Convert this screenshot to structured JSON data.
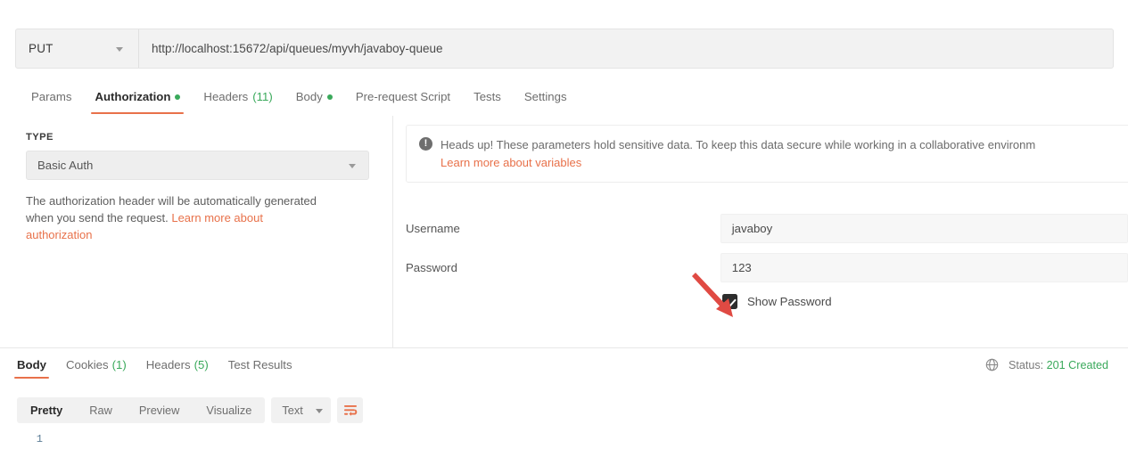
{
  "request": {
    "method": "PUT",
    "url": "http://localhost:15672/api/queues/myvh/javaboy-queue",
    "tabs": [
      {
        "label": "Params",
        "badge": "",
        "dot": false,
        "active": false
      },
      {
        "label": "Authorization",
        "badge": "",
        "dot": true,
        "active": true
      },
      {
        "label": "Headers",
        "badge": "(11)",
        "dot": false,
        "active": false
      },
      {
        "label": "Body",
        "badge": "",
        "dot": true,
        "active": false
      },
      {
        "label": "Pre-request Script",
        "badge": "",
        "dot": false,
        "active": false
      },
      {
        "label": "Tests",
        "badge": "",
        "dot": false,
        "active": false
      },
      {
        "label": "Settings",
        "badge": "",
        "dot": false,
        "active": false
      }
    ]
  },
  "auth": {
    "type_label": "TYPE",
    "type_value": "Basic Auth",
    "note_text": "The authorization header will be automatically generated when you send the request. ",
    "note_link": "Learn more about authorization",
    "notice_text": "Heads up! These parameters hold sensitive data. To keep this data secure while working in a collaborative environm",
    "notice_link": "Learn more about variables",
    "username_label": "Username",
    "username_value": "javaboy",
    "password_label": "Password",
    "password_value": "123",
    "show_password_label": "Show Password",
    "show_password_checked": true
  },
  "response": {
    "tabs": [
      {
        "label": "Body",
        "badge": "",
        "active": true
      },
      {
        "label": "Cookies",
        "badge": "(1)",
        "active": false
      },
      {
        "label": "Headers",
        "badge": "(5)",
        "active": false
      },
      {
        "label": "Test Results",
        "badge": "",
        "active": false
      }
    ],
    "status_prefix": "Status:",
    "status_code": "201 Created",
    "formats": [
      {
        "label": "Pretty",
        "active": true
      },
      {
        "label": "Raw",
        "active": false
      },
      {
        "label": "Preview",
        "active": false
      },
      {
        "label": "Visualize",
        "active": false
      }
    ],
    "content_type": "Text",
    "line_number": "1"
  },
  "icons": {
    "method_caret": "chevron-down-icon",
    "type_caret": "chevron-down-icon",
    "notice": "exclamation-circle-icon",
    "globe": "globe-icon",
    "wordwrap": "word-wrap-icon",
    "checkbox": "checkbox-checked-icon",
    "annotation": "red-arrow-annotation"
  },
  "colors": {
    "accent_orange": "#e8714a",
    "green": "#3aa95b",
    "annotation_red": "#e04a43",
    "panel_bg": "#f2f2f2"
  }
}
